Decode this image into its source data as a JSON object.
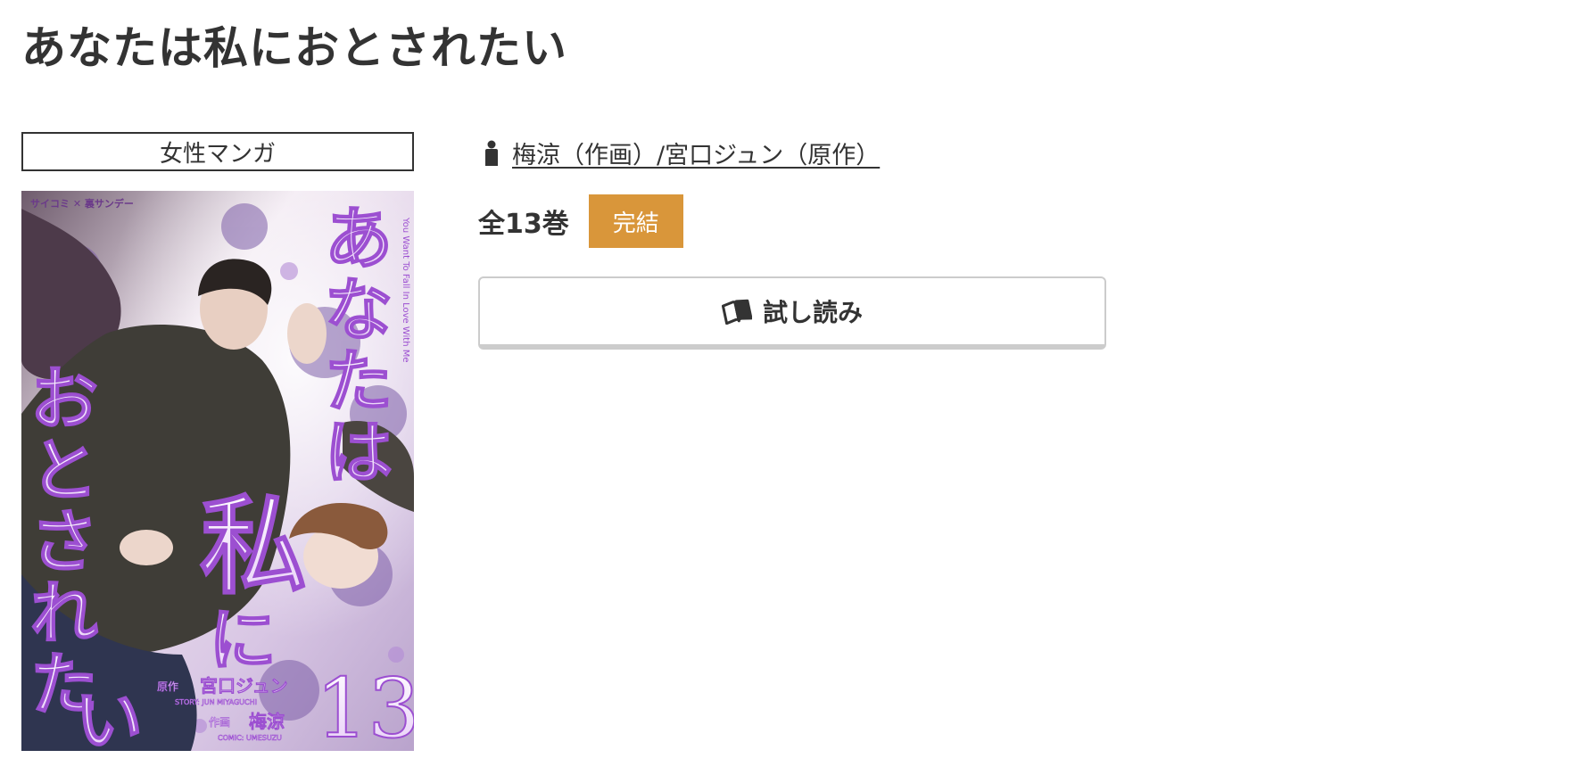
{
  "title": "あなたは私におとされたい",
  "genre": "女性マンガ",
  "cover": {
    "alt": "あなたは私におとされたい 13",
    "publisher_logo": "サイコミ ✕ 裏サンデー",
    "title_vertical": "あなたは私におとされたい",
    "volume_number": "13",
    "credit_story_label": "原作",
    "credit_story_name": "宮口ジュン",
    "credit_story_roman": "STORY: JUN MIYAGUCHI",
    "credit_art_label": "作画",
    "credit_art_name": "梅涼",
    "credit_art_roman": "COMIC: UMESUZU",
    "side_text": "You Want To Fall In Love With Me",
    "accent_color": "#9c4fd1"
  },
  "author": {
    "icon": "person-icon",
    "text": "梅涼（作画）/宮口ジュン（原作）"
  },
  "volumes": {
    "count_text": "全13巻",
    "status": "完結",
    "status_color": "#d9963a"
  },
  "trial": {
    "icon": "open-book-icon",
    "label": "試し読み"
  }
}
